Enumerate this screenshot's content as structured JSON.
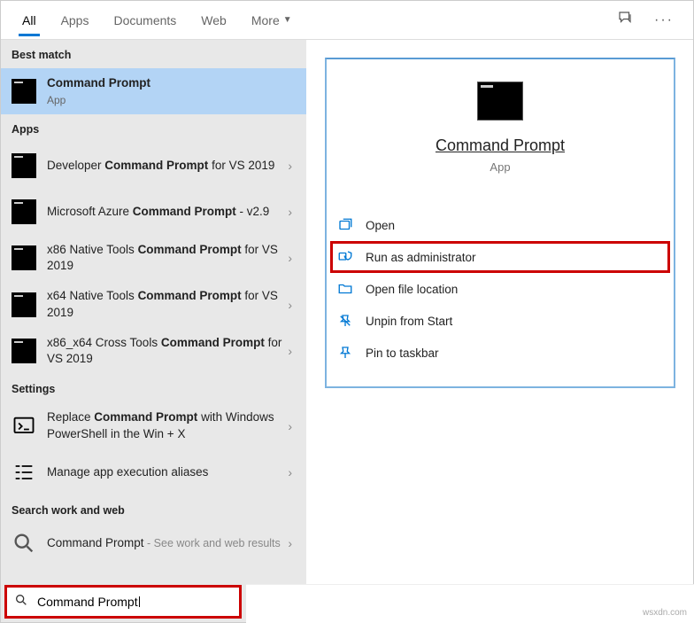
{
  "tabs": {
    "all": "All",
    "apps": "Apps",
    "documents": "Documents",
    "web": "Web",
    "more": "More"
  },
  "sections": {
    "best_match": "Best match",
    "apps": "Apps",
    "settings": "Settings",
    "search_web": "Search work and web"
  },
  "best_match": {
    "title": "Command Prompt",
    "type": "App"
  },
  "apps_list": [
    {
      "pre": "Developer ",
      "bold": "Command Prompt",
      "post": " for VS 2019"
    },
    {
      "pre": "Microsoft Azure ",
      "bold": "Command Prompt",
      "post": " - v2.9"
    },
    {
      "pre": "x86 Native Tools ",
      "bold": "Command Prompt",
      "post": " for VS 2019"
    },
    {
      "pre": "x64 Native Tools ",
      "bold": "Command Prompt",
      "post": " for VS 2019"
    },
    {
      "pre": "x86_x64 Cross Tools ",
      "bold": "Command Prompt",
      "post": " for VS 2019"
    }
  ],
  "settings_list": [
    {
      "pre": "Replace ",
      "bold": "Command Prompt",
      "post": " with Windows PowerShell in the Win + X"
    },
    {
      "pre": "Manage app execution aliases",
      "bold": "",
      "post": ""
    }
  ],
  "web_list": [
    {
      "title": "Command Prompt",
      "hint": " - See work and web results"
    }
  ],
  "preview": {
    "title": "Command Prompt",
    "type": "App"
  },
  "actions": {
    "open": "Open",
    "run_admin": "Run as administrator",
    "open_location": "Open file location",
    "unpin_start": "Unpin from Start",
    "pin_taskbar": "Pin to taskbar"
  },
  "search_input": "Command Prompt",
  "watermark": "wsxdn.com"
}
